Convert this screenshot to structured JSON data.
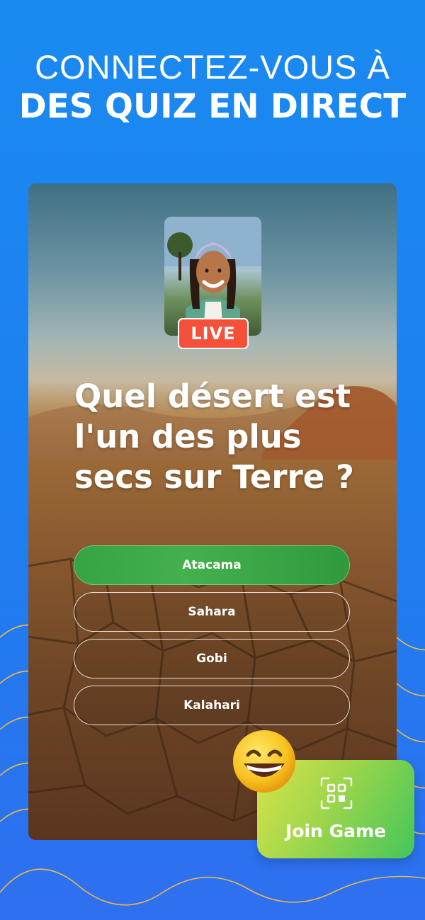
{
  "headline": {
    "line1": "CONNECTEZ-VOUS À",
    "line2": "DES QUIZ EN DIRECT"
  },
  "card": {
    "live_badge": "LIVE",
    "question_lines": [
      "Quel désert est",
      "l'un des plus",
      "secs sur Terre ?"
    ],
    "answers": [
      {
        "label": "Atacama",
        "state": "correct"
      },
      {
        "label": "Sahara",
        "state": "default"
      },
      {
        "label": "Gobi",
        "state": "default"
      },
      {
        "label": "Kalahari",
        "state": "default"
      }
    ]
  },
  "join_button": {
    "label": "Join Game",
    "icon": "qr-code-icon"
  },
  "emoji_icon": "grinning-face-icon",
  "colors": {
    "background": "#1d7ff0",
    "live": "#f4503a",
    "correct_answer": "#3aa846",
    "join_gradient_start": "#d9e34a",
    "join_gradient_end": "#43c65a",
    "wave_lines": "#e8b84a"
  }
}
